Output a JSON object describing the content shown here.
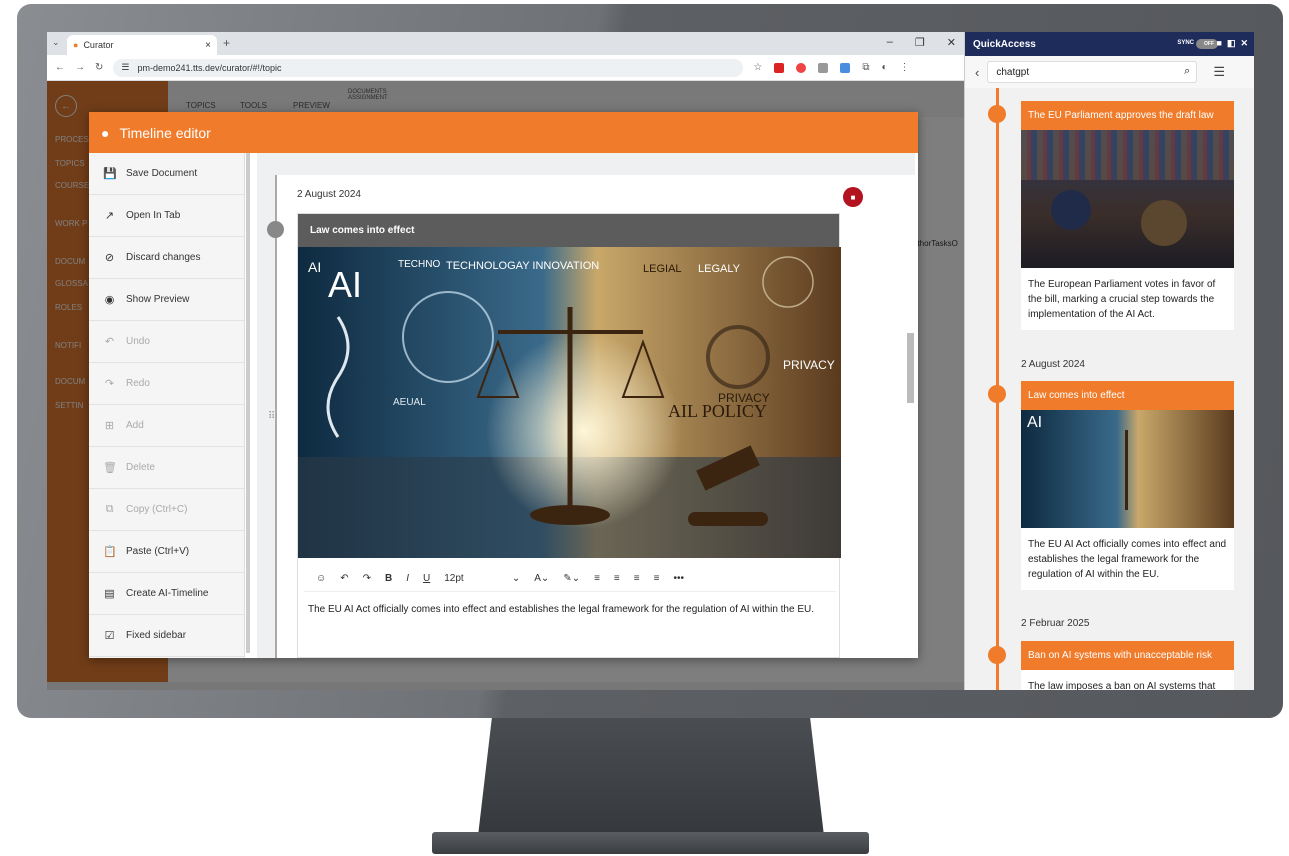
{
  "browser": {
    "tab_title": "Curator",
    "url": "pm-demo241.tts.dev/curator/#!/topic"
  },
  "background_app": {
    "nav": [
      "PROCESS",
      "TOPICS",
      "COURSE",
      "WORK P",
      "DOCUM",
      "GLOSSA",
      "ROLES",
      "NOTIFI",
      "DOCUM",
      "SETTIN"
    ],
    "tabs": [
      "TOPICS",
      "TOOLS",
      "PREVIEW",
      "DOCUMENTS ASSIGNMENT"
    ],
    "column_label": "uthorTasksO"
  },
  "editor": {
    "title": "Timeline editor",
    "menu": [
      {
        "label": "Save Document",
        "enabled": true,
        "icon": "save-icon"
      },
      {
        "label": "Open In Tab",
        "enabled": true,
        "icon": "open-tab-icon"
      },
      {
        "label": "Discard changes",
        "enabled": true,
        "icon": "discard-icon"
      },
      {
        "label": "Show Preview",
        "enabled": true,
        "icon": "eye-icon"
      },
      {
        "label": "Undo",
        "enabled": false,
        "icon": "undo-icon"
      },
      {
        "label": "Redo",
        "enabled": false,
        "icon": "redo-icon"
      },
      {
        "label": "Add",
        "enabled": false,
        "icon": "add-icon"
      },
      {
        "label": "Delete",
        "enabled": false,
        "icon": "trash-icon"
      },
      {
        "label": "Copy (Ctrl+C)",
        "enabled": false,
        "icon": "copy-icon"
      },
      {
        "label": "Paste (Ctrl+V)",
        "enabled": true,
        "icon": "paste-icon"
      },
      {
        "label": "Create AI-Timeline",
        "enabled": true,
        "icon": "timeline-icon"
      },
      {
        "label": "Fixed sidebar",
        "enabled": true,
        "icon": "checkbox-icon"
      }
    ],
    "entry": {
      "date": "2 August 2024",
      "title": "Law comes into effect",
      "font_size": "12pt",
      "text": "The EU AI Act officially comes into effect and establishes the legal framework for the regulation of AI within the EU."
    },
    "image_words": [
      "AI",
      "TECHNO",
      "TECHNOLOGAY INNOVATION",
      "LEGIAL",
      "LEGALY",
      "PRIVACY",
      "AIL POLICY",
      "AEUAL"
    ]
  },
  "quickaccess": {
    "title": "QuickAccess",
    "sync_label": "SYNC",
    "toggle_label": "OFF",
    "search_value": "chatgpt",
    "items": [
      {
        "date": "",
        "title": "The EU Parliament approves the draft law",
        "body": "The European Parliament votes in favor of the bill, marking a crucial step towards the implementation of the AI Act."
      },
      {
        "date": "2 August 2024",
        "title": "Law comes into effect",
        "body": "The EU AI Act officially comes into effect and establishes the legal framework for the regulation of AI within the EU."
      },
      {
        "date": "2 Februar 2025",
        "title": "Ban on AI systems with unacceptable risk",
        "body": "The law imposes a ban on AI systems that"
      }
    ]
  },
  "colors": {
    "accent": "#f07b2a",
    "header_blue": "#1e2c5c",
    "delete_red": "#b3121f"
  }
}
